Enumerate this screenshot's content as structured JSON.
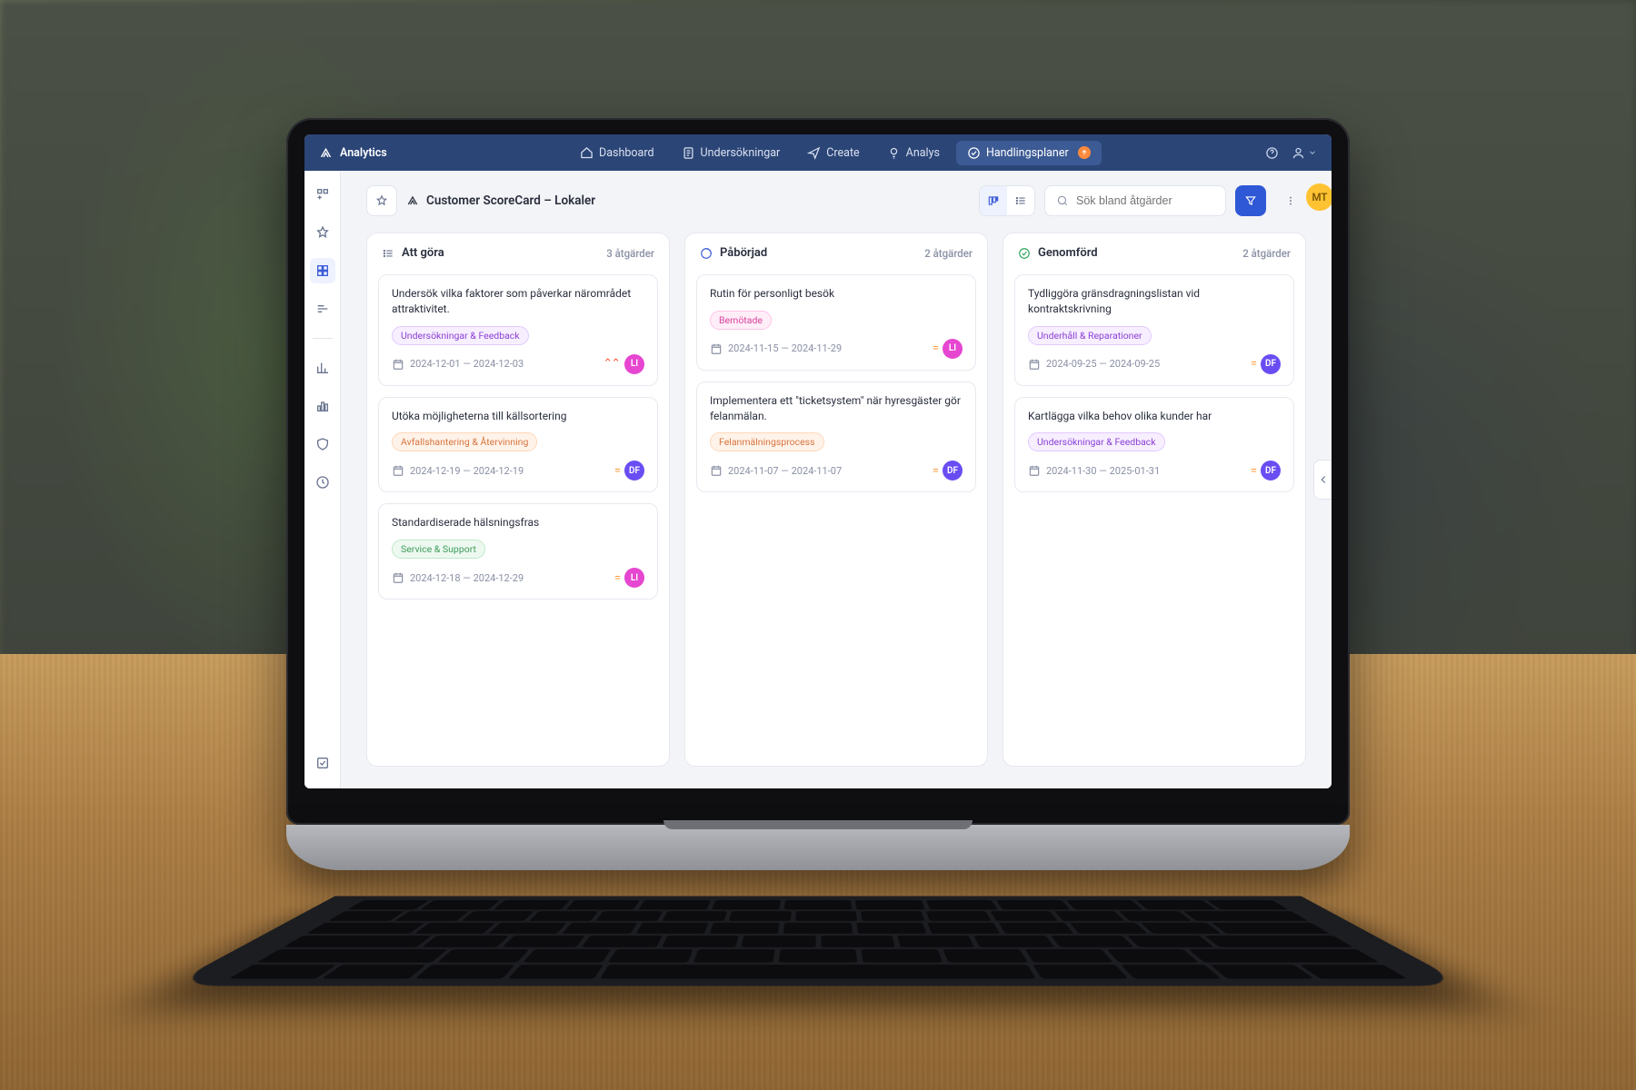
{
  "header": {
    "app_name": "Analytics",
    "nav": [
      {
        "label": "Dashboard"
      },
      {
        "label": "Undersökningar"
      },
      {
        "label": "Create"
      },
      {
        "label": "Analys"
      },
      {
        "label": "Handlingsplaner",
        "active": true,
        "has_badge": true
      }
    ]
  },
  "user": {
    "initials": "MT"
  },
  "page": {
    "title": "Customer ScoreCard – Lokaler",
    "search_placeholder": "Sök bland åtgärder"
  },
  "board": {
    "columns": [
      {
        "status": "todo",
        "title": "Att göra",
        "count_label": "3 åtgärder",
        "cards": [
          {
            "title": "Undersök vilka faktorer som påverkar närområdet attraktivitet.",
            "tag": "Undersökningar & Feedback",
            "tag_color": "purple",
            "dates": "2024-12-01 — 2024-12-03",
            "priority": "high",
            "assignee": "LI",
            "assignee_color": "pink"
          },
          {
            "title": "Utöka möjligheterna till källsortering",
            "tag": "Avfallshantering & Återvinning",
            "tag_color": "orange",
            "dates": "2024-12-19 — 2024-12-19",
            "priority": "medium",
            "assignee": "DF",
            "assignee_color": "violet"
          },
          {
            "title": "Standardiserade hälsningsfras",
            "tag": "Service & Support",
            "tag_color": "green",
            "dates": "2024-12-18 — 2024-12-29",
            "priority": "medium",
            "assignee": "LI",
            "assignee_color": "pink"
          }
        ]
      },
      {
        "status": "in_progress",
        "title": "Påbörjad",
        "count_label": "2 åtgärder",
        "cards": [
          {
            "title": "Rutin för personligt besök",
            "tag": "Bemötade",
            "tag_color": "pink",
            "dates": "2024-11-15 — 2024-11-29",
            "priority": "medium",
            "assignee": "LI",
            "assignee_color": "pink"
          },
          {
            "title": "Implementera ett \"ticketsystem\" när hyresgäster gör felanmälan.",
            "tag": "Felanmälningsprocess",
            "tag_color": "orange",
            "dates": "2024-11-07 — 2024-11-07",
            "priority": "medium",
            "assignee": "DF",
            "assignee_color": "violet"
          }
        ]
      },
      {
        "status": "done",
        "title": "Genomförd",
        "count_label": "2 åtgärder",
        "cards": [
          {
            "title": "Tydliggöra gränsdragningslistan vid kontraktskrivning",
            "tag": "Underhåll & Reparationer",
            "tag_color": "purple",
            "dates": "2024-09-25 — 2024-09-25",
            "priority": "medium",
            "assignee": "DF",
            "assignee_color": "violet"
          },
          {
            "title": "Kartlägga vilka behov olika kunder har",
            "tag": "Undersökningar & Feedback",
            "tag_color": "purple",
            "dates": "2024-11-30 — 2025-01-31",
            "priority": "medium",
            "assignee": "DF",
            "assignee_color": "violet"
          }
        ]
      }
    ]
  }
}
